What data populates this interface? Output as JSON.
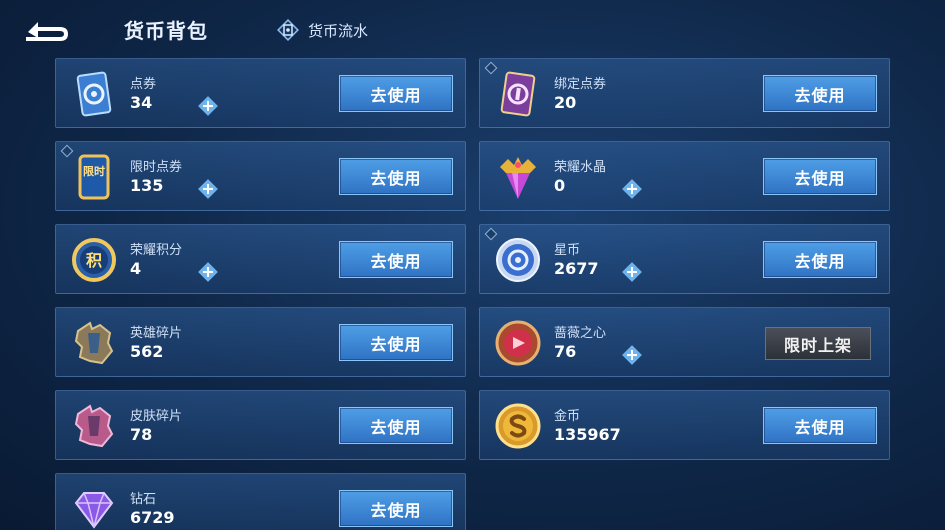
{
  "header": {
    "title": "货币背包",
    "flow_label": "货币流水"
  },
  "button_label": "去使用",
  "limited_label": "限时上架",
  "currencies": [
    {
      "name": "点券",
      "amount": "34",
      "icon": "coupon-icon"
    },
    {
      "name": "绑定点券",
      "amount": "20",
      "icon": "bound-coupon-icon"
    },
    {
      "name": "限时点券",
      "amount": "135",
      "icon": "limited-coupon-icon",
      "badge": "限时"
    },
    {
      "name": "荣耀水晶",
      "amount": "0",
      "icon": "glory-crystal-icon"
    },
    {
      "name": "荣耀积分",
      "amount": "4",
      "icon": "glory-points-icon",
      "badge": "积"
    },
    {
      "name": "星币",
      "amount": "2677",
      "icon": "star-coin-icon"
    },
    {
      "name": "英雄碎片",
      "amount": "562",
      "icon": "hero-fragment-icon"
    },
    {
      "name": "蔷薇之心",
      "amount": "76",
      "icon": "rose-heart-icon"
    },
    {
      "name": "皮肤碎片",
      "amount": "78",
      "icon": "skin-fragment-icon"
    },
    {
      "name": "金币",
      "amount": "135967",
      "icon": "gold-coin-icon"
    },
    {
      "name": "钻石",
      "amount": "6729",
      "icon": "diamond-icon"
    }
  ],
  "colors": {
    "button": "#3b86d6",
    "background": "#0f2748",
    "card": "#2a5590",
    "limited_button": "#3a3f48"
  }
}
